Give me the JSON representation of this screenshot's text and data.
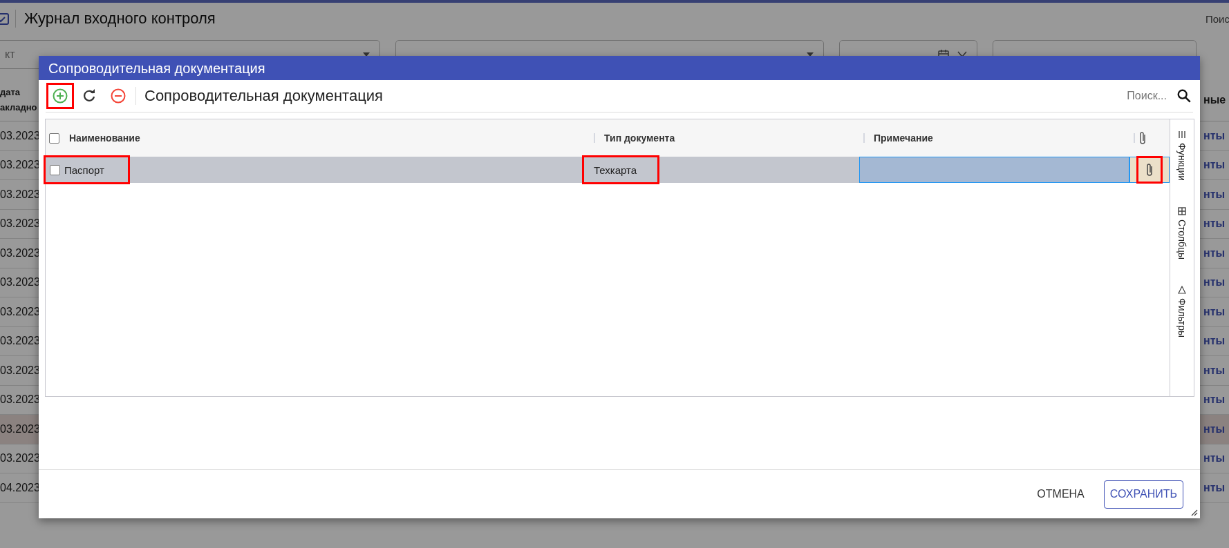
{
  "page": {
    "title": "Журнал входного контроля",
    "search_label": "Поис",
    "filters": [
      {
        "kind": "dropdown",
        "placeholder": "кт"
      },
      {
        "kind": "dropdown"
      },
      {
        "kind": "date"
      },
      {
        "kind": "text"
      }
    ],
    "table": {
      "columns": [
        "дата акладно",
        "ные"
      ],
      "rows": [
        {
          "column_1": "03.2023",
          "column_2": "нты",
          "selected": false
        },
        {
          "column_1": "03.2023",
          "column_2": "нты",
          "selected": false
        },
        {
          "column_1": "03.2023",
          "column_2": "нты",
          "selected": false
        },
        {
          "column_1": "03.2023",
          "column_2": "нты",
          "selected": false
        },
        {
          "column_1": "03.2023",
          "column_2": "нты",
          "selected": false
        },
        {
          "column_1": "03.2023",
          "column_2": "нты",
          "selected": false
        },
        {
          "column_1": "03.2023",
          "column_2": "нты",
          "selected": false
        },
        {
          "column_1": "03.2023",
          "column_2": "нты",
          "selected": false
        },
        {
          "column_1": "03.2023",
          "column_2": "нты",
          "selected": false
        },
        {
          "column_1": "03.2023",
          "column_2": "нты",
          "selected": false
        },
        {
          "column_1": "03.2023",
          "column_2": "нты",
          "selected": true
        },
        {
          "column_1": "03.2023",
          "column_2": "нты",
          "selected": false
        },
        {
          "column_1": "04.2023",
          "column_2": "нты",
          "selected": false
        }
      ]
    }
  },
  "dialog": {
    "title": "Сопроводительная документация",
    "toolbar": {
      "buttons": [
        {
          "kind": "add",
          "highlighted": true
        },
        {
          "kind": "refresh",
          "highlighted": false
        },
        {
          "kind": "remove",
          "highlighted": false
        }
      ],
      "title": "Сопроводительная документация",
      "search_placeholder": "Поиск..."
    },
    "table": {
      "header_checked": false,
      "columns": [
        {
          "kind": "text",
          "label": "Наименование"
        },
        {
          "kind": "text",
          "label": "Тип документа"
        },
        {
          "kind": "text",
          "label": "Примечание"
        },
        {
          "kind": "attachment"
        }
      ],
      "rows": [
        {
          "selected": true,
          "checked": false,
          "name": "Паспорт",
          "name_highlighted": true,
          "type": "Техкарта",
          "type_highlighted": true,
          "note_focused": true,
          "attachment_highlighted": true
        }
      ]
    },
    "side_panel": [
      {
        "kind": "functions",
        "label": "Функции"
      },
      {
        "kind": "columns",
        "label": "Столбцы"
      },
      {
        "kind": "filters",
        "label": "Фильтры"
      }
    ],
    "buttons": [
      {
        "kind": "text",
        "label": "ОТМЕНА"
      },
      {
        "kind": "outlined",
        "label": "СОХРАНИТЬ"
      }
    ]
  }
}
